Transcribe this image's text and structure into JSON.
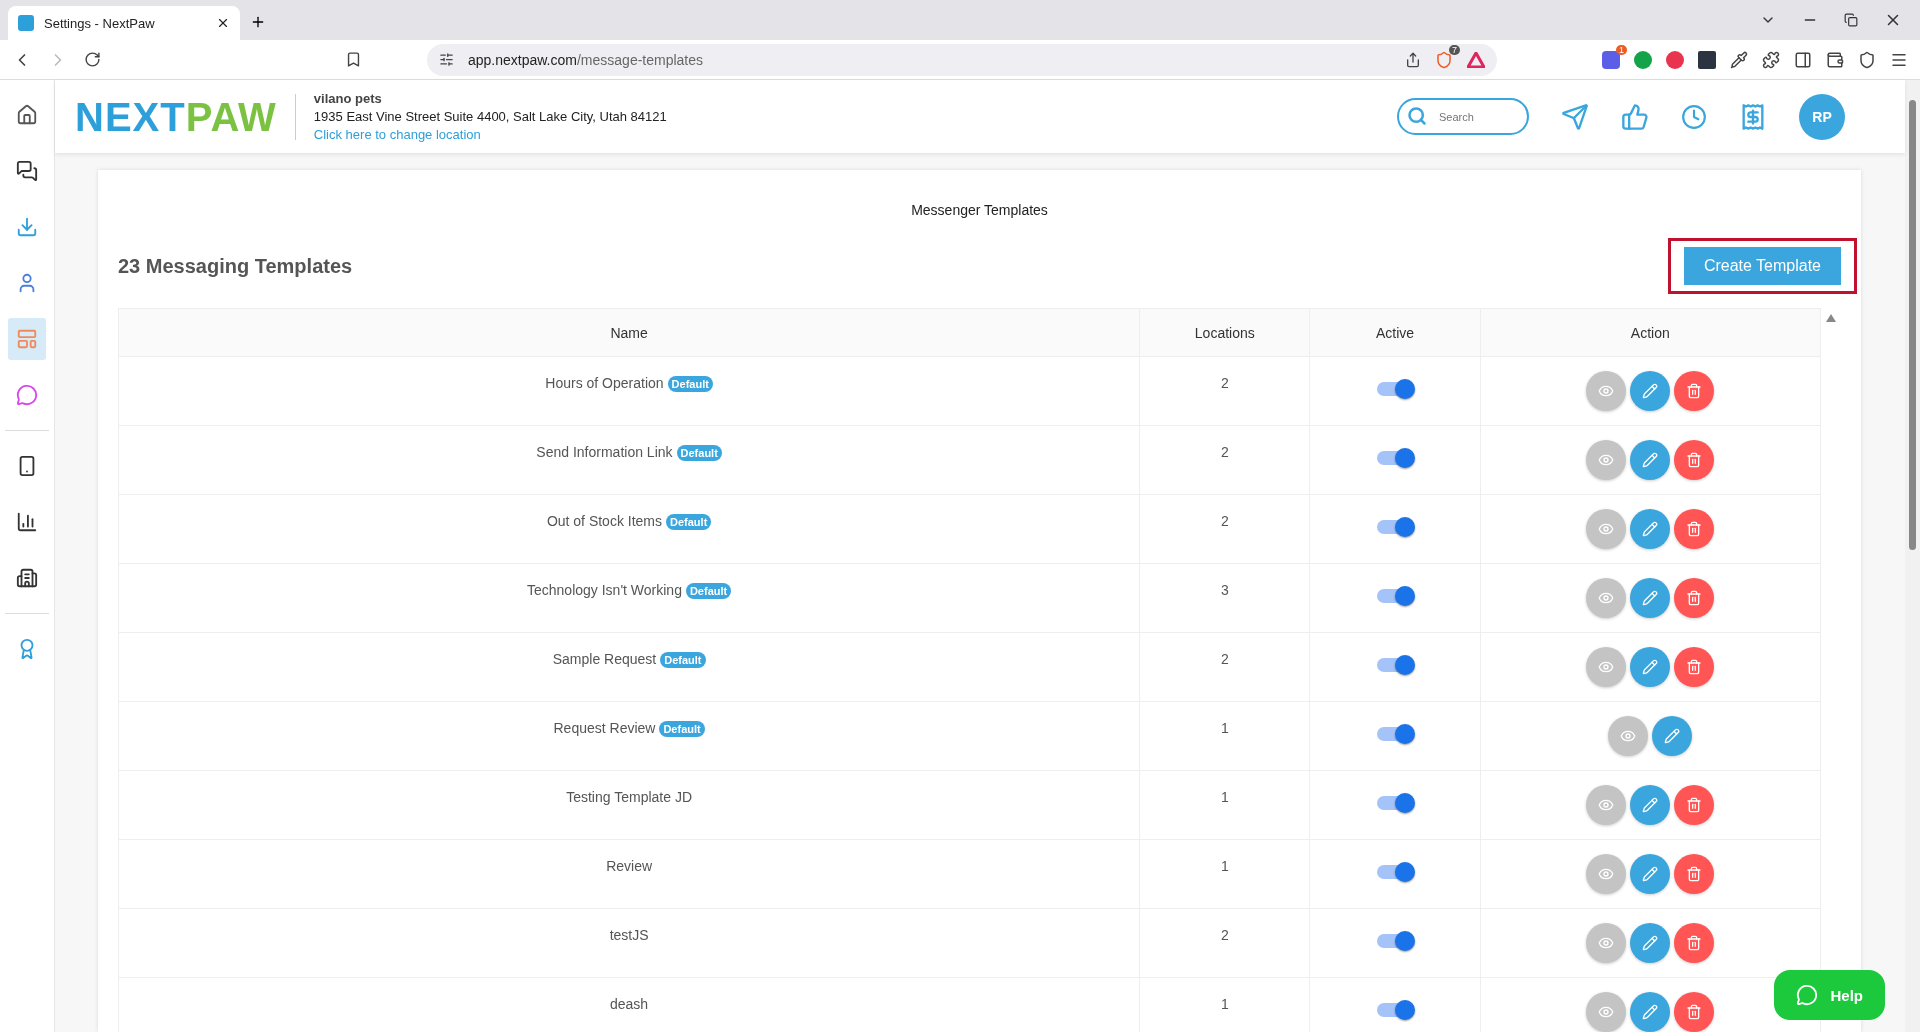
{
  "browser": {
    "tab_title": "Settings - NextPaw",
    "url_host": "app.nextpaw.com",
    "url_path": "/message-templates",
    "shield_count": "7",
    "extension_count": "1"
  },
  "sidebar": {
    "items": [
      {
        "kind": "item",
        "selected": false
      },
      {
        "kind": "item",
        "selected": false
      },
      {
        "kind": "item",
        "selected": false
      },
      {
        "kind": "item",
        "selected": false
      },
      {
        "kind": "item",
        "selected": true
      },
      {
        "kind": "item",
        "selected": false
      },
      {
        "kind": "divider"
      },
      {
        "kind": "item",
        "selected": false
      },
      {
        "kind": "item",
        "selected": false
      },
      {
        "kind": "item",
        "selected": false
      },
      {
        "kind": "divider"
      },
      {
        "kind": "item",
        "selected": false
      }
    ]
  },
  "header": {
    "logo": {
      "first": "NEXT",
      "second": "PAW"
    },
    "business": "vilano pets",
    "address": "1935 East Vine Street Suite 4400, Salt Lake City, Utah 84121",
    "change_link": "Click here to change location",
    "search": {
      "placeholder": "Search"
    },
    "avatar": "RP"
  },
  "page": {
    "title": "Messenger Templates",
    "count_heading": "23 Messaging Templates",
    "create_button": "Create Template"
  },
  "table": {
    "columns": [
      "Name",
      "Locations",
      "Active",
      "Action"
    ],
    "rows": [
      {
        "name": "Hours of Operation",
        "badge": "Default",
        "locations": "2",
        "active": true,
        "deletable": true
      },
      {
        "name": "Send Information Link",
        "badge": "Default",
        "locations": "2",
        "active": true,
        "deletable": true
      },
      {
        "name": "Out of Stock Items",
        "badge": "Default",
        "locations": "2",
        "active": true,
        "deletable": true
      },
      {
        "name": "Technology Isn't Working",
        "badge": "Default",
        "locations": "3",
        "active": true,
        "deletable": true
      },
      {
        "name": "Sample Request",
        "badge": "Default",
        "locations": "2",
        "active": true,
        "deletable": true
      },
      {
        "name": "Request Review",
        "badge": "Default",
        "locations": "1",
        "active": true,
        "deletable": false
      },
      {
        "name": "Testing Template JD",
        "locations": "1",
        "active": true,
        "deletable": true
      },
      {
        "name": "Review",
        "locations": "1",
        "active": true,
        "deletable": true
      },
      {
        "name": "testJS",
        "locations": "2",
        "active": true,
        "deletable": true
      },
      {
        "name": "deash",
        "locations": "1",
        "active": true,
        "deletable": true
      }
    ]
  },
  "help_button": "Help"
}
